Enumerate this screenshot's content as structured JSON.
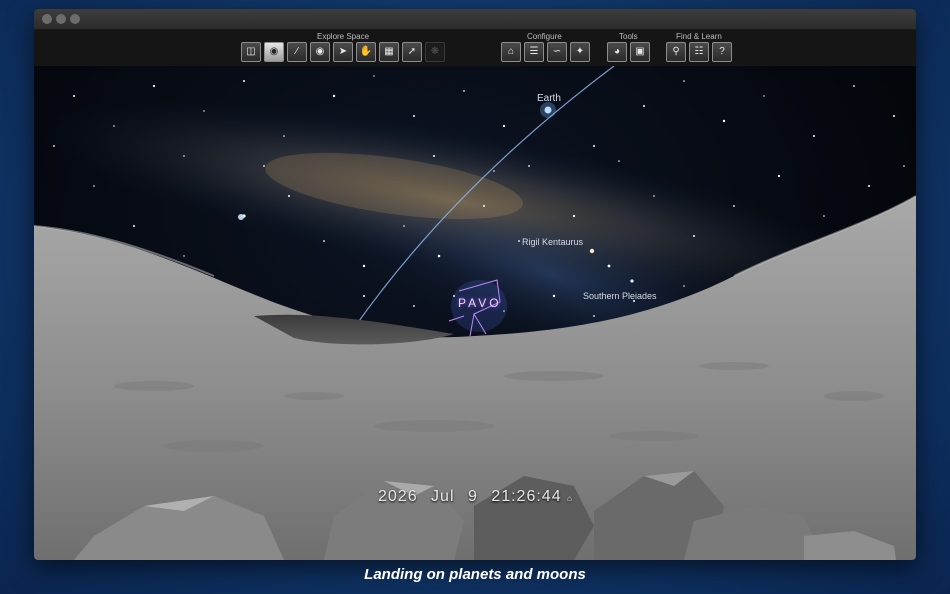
{
  "toolbar": {
    "groups": {
      "explore_space": "Explore Space",
      "configure": "Configure",
      "tools": "Tools",
      "find_learn": "Find & Learn"
    },
    "icons": {
      "explore": [
        "save-icon",
        "location-pin-icon",
        "telescope-icon",
        "eye-icon",
        "rocket-icon",
        "hand-icon",
        "calendar-icon",
        "telescope-mount-icon",
        "satellite-icon"
      ],
      "configure": [
        "home-icon",
        "sliders-icon",
        "horizon-icon",
        "constellation-grid-icon"
      ],
      "tools": [
        "gauge-icon",
        "add-view-icon"
      ],
      "find": [
        "search-icon",
        "book-icon",
        "help-icon"
      ]
    }
  },
  "sky": {
    "earth_label": "Earth",
    "rigil_label": "Rigil Kentaurus",
    "pleiades_label": "Southern Pleiades",
    "constellation_label": "PAVO"
  },
  "status": {
    "year": "2026",
    "month": "Jul",
    "day": "9",
    "time": "21:26:44"
  },
  "caption": "Landing on planets and moons"
}
